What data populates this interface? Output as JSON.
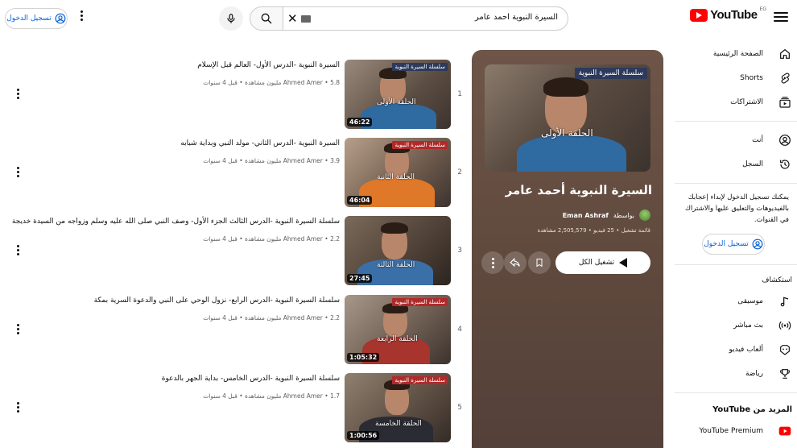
{
  "header": {
    "logo_text": "YouTube",
    "logo_region": "EG",
    "search_query": "السيرة النبوية احمد عامر",
    "signin_label": "تسجيل الدخول"
  },
  "sidebar": {
    "main": [
      {
        "label": "الصفحة الرئيسية",
        "icon": "home-icon"
      },
      {
        "label": "Shorts",
        "icon": "shorts-icon"
      },
      {
        "label": "الاشتراكات",
        "icon": "subscriptions-icon"
      }
    ],
    "you": [
      {
        "label": "أنت",
        "icon": "user-icon"
      },
      {
        "label": "السجل",
        "icon": "history-icon"
      }
    ],
    "signin_note": "يمكنك تسجيل الدخول لإبداء إعجابك بالفيديوهات والتعليق عليها والاشتراك في القنوات.",
    "signin_label": "تسجيل الدخول",
    "explore_heading": "استكشاف",
    "explore": [
      {
        "label": "موسيقى",
        "icon": "music-icon"
      },
      {
        "label": "بث مباشر",
        "icon": "live-icon"
      },
      {
        "label": "ألعاب فيديو",
        "icon": "gaming-icon"
      },
      {
        "label": "رياضة",
        "icon": "trophy-icon"
      }
    ],
    "more_heading": "المزيد من YouTube",
    "more": [
      {
        "label": "YouTube Premium",
        "icon": "youtube-premium-icon"
      }
    ]
  },
  "playlist": {
    "title": "السيرة النبوية أحمد عامر",
    "owner": "Eman Ashraf",
    "owner_prefix": "بواسطة",
    "meta": "قائمة تشغيل • 25 فيديو • 2,505,579 مشاهدة",
    "play_all_label": "تشغيل الكل",
    "thumb_banner": "سلسلة السيرة النبوية",
    "thumb_caption": "الحلقة الأولى"
  },
  "videos": [
    {
      "index": "1",
      "title": "السيرة النبوية -الدرس الأول- العالم قبل الإسلام",
      "channel": "Ahmed Amer",
      "stats": "5.8 مليون مشاهدة • قبل 4 سنوات",
      "duration": "46:22",
      "banner": "سلسلة السيرة النبوية",
      "caption": "الحلقة الأولى"
    },
    {
      "index": "2",
      "title": "السيرة النبوية -الدرس الثاني- مولد النبي وبداية شبابه",
      "channel": "Ahmed Amer",
      "stats": "3.9 مليون مشاهدة • قبل 4 سنوات",
      "duration": "46:04",
      "banner": "سلسلة السيرة النبوية",
      "caption": "الحلقة الثانية"
    },
    {
      "index": "3",
      "title": "سلسلة السيرة النبوية -الدرس الثالث الجزء الأول- وصف النبي صلى الله عليه وسلم وزواجه من السيدة خديجة",
      "channel": "Ahmed Amer",
      "stats": "2.2 مليون مشاهدة • قبل 4 سنوات",
      "duration": "27:45",
      "banner": "",
      "caption": "الحلقة الثالثة"
    },
    {
      "index": "4",
      "title": "سلسلة السيرة النبوية -الدرس الرابع- نزول الوحي على النبي والدعوة السرية بمكة",
      "channel": "Ahmed Amer",
      "stats": "2.2 مليون مشاهدة • قبل 4 سنوات",
      "duration": "1:05:32",
      "banner": "سلسلة السيرة النبوية",
      "caption": "الحلقة الرابعة"
    },
    {
      "index": "5",
      "title": "سلسلة السيرة النبوية -الدرس الخامس- بداية الجهر بالدعوة",
      "channel": "Ahmed Amer",
      "stats": "1.7 مليون مشاهدة • قبل 4 سنوات",
      "duration": "1:00:56",
      "banner": "سلسلة السيرة النبوية",
      "caption": "الحلقة الخامسة"
    }
  ],
  "colors": {
    "brand_red": "#ff0000",
    "link_blue": "#065fd4",
    "panel_bg": "#6e5548"
  }
}
